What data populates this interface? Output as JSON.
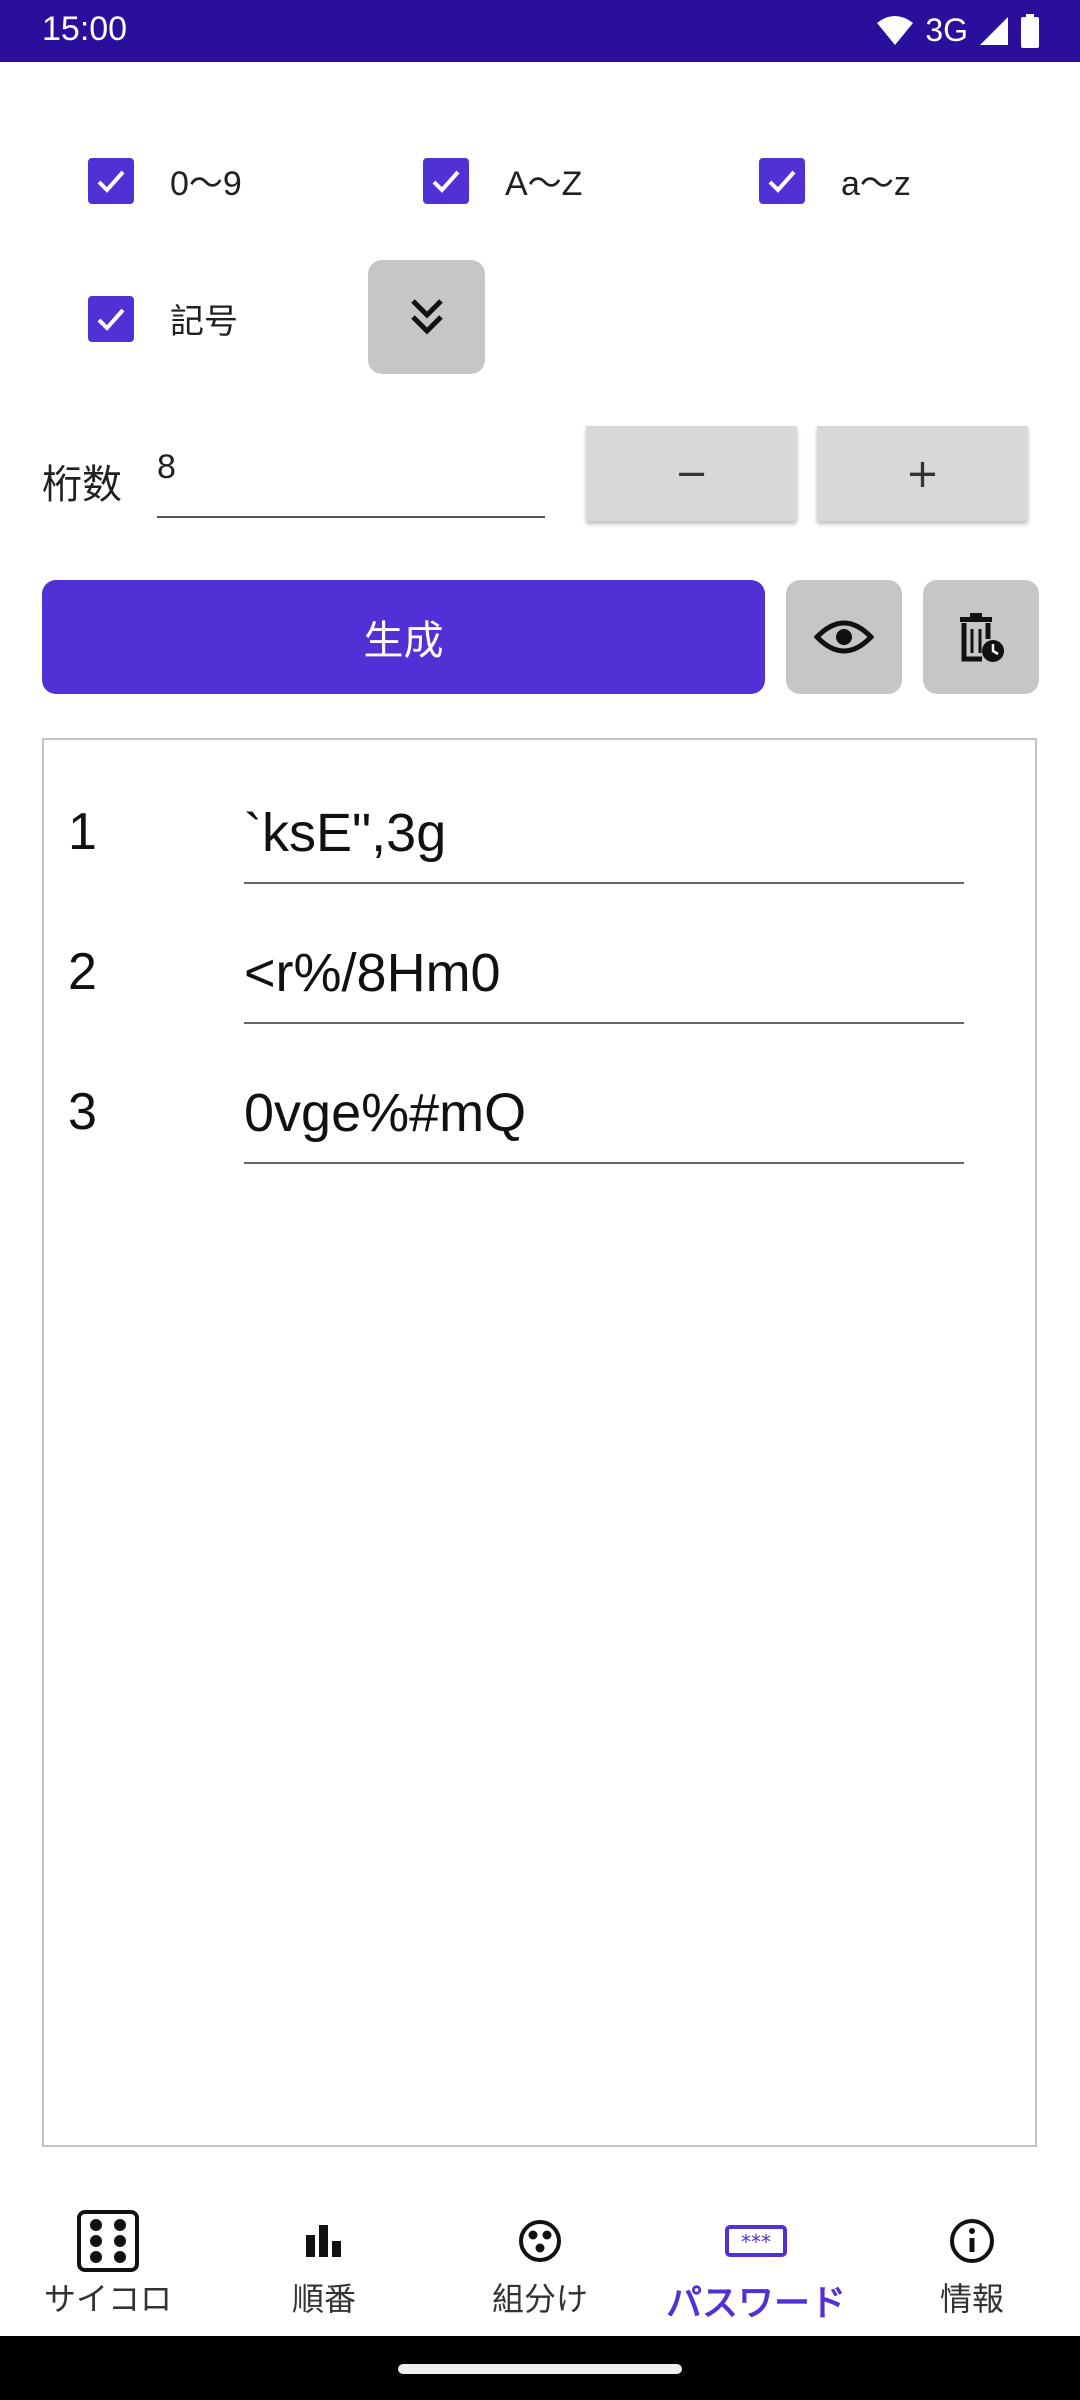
{
  "status_bar": {
    "time": "15:00",
    "network": "3G"
  },
  "options": {
    "digits": {
      "label": "0〜9",
      "checked": true
    },
    "upper": {
      "label": "A〜Z",
      "checked": true
    },
    "lower": {
      "label": "a〜z",
      "checked": true
    },
    "symbols": {
      "label": "記号",
      "checked": true
    }
  },
  "length": {
    "label": "桁数",
    "value": "8",
    "minus": "−",
    "plus": "+"
  },
  "generate_label": "生成",
  "passwords": [
    {
      "index": "1",
      "value": "`ksE\",3g"
    },
    {
      "index": "2",
      "value": "<r%/8Hm0"
    },
    {
      "index": "3",
      "value": "0vge%#mQ"
    }
  ],
  "bottom_nav": [
    {
      "label": "サイコロ",
      "icon": "dice-icon",
      "active": false
    },
    {
      "label": "順番",
      "icon": "bar-chart-icon",
      "active": false
    },
    {
      "label": "組分け",
      "icon": "group-icon",
      "active": false
    },
    {
      "label": "パスワード",
      "icon": "password-icon",
      "active": true
    },
    {
      "label": "情報",
      "icon": "info-icon",
      "active": false
    }
  ],
  "colors": {
    "accent": "#5130d5",
    "status_bar": "#2a0e9c"
  }
}
